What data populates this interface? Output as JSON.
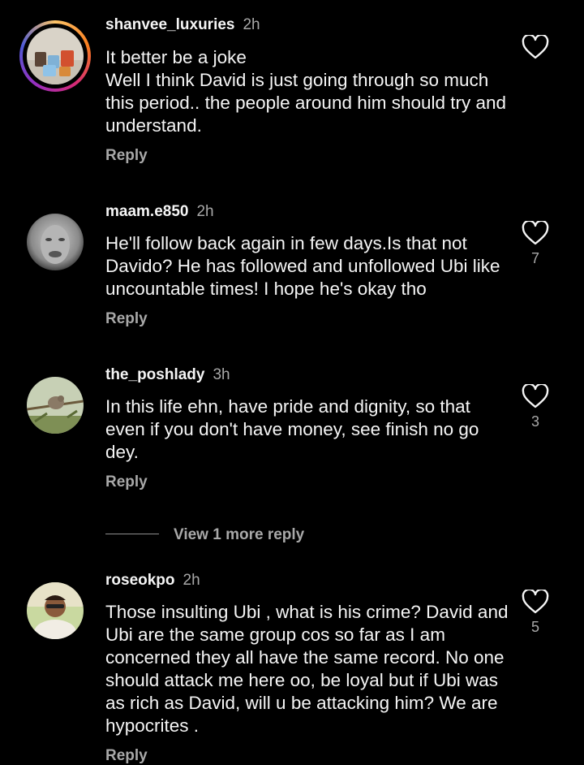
{
  "comments": [
    {
      "username": "shanvee_luxuries",
      "time": "2h",
      "text": "It better be a joke\nWell I think David is just going through so much this period.. the people around him should try and understand.",
      "reply": "Reply",
      "likes": ""
    },
    {
      "username": "maam.e850",
      "time": "2h",
      "text": "He'll follow back again in few days.Is that not Davido? He has followed and unfollowed Ubi like uncountable times! I hope he's okay tho",
      "reply": "Reply",
      "likes": "7"
    },
    {
      "username": "the_poshlady",
      "time": "3h",
      "text": "In this life ehn, have pride and dignity, so that even if you don't have money, see finish no go dey.",
      "reply": "Reply",
      "likes": "3"
    },
    {
      "username": "roseokpo",
      "time": "2h",
      "text": "Those insulting Ubi , what is his crime? David and Ubi are the same group cos so far as I am concerned they all have the same record. No one should attack me here oo, be loyal but if Ubi was as rich as David, will u be attacking him? We are hypocrites .",
      "reply": "Reply",
      "likes": "5"
    }
  ],
  "view_more": "View 1 more reply",
  "icons": {
    "like": "heart-outline-icon"
  },
  "colors": {
    "background": "#000000",
    "text": "#f5f5f5",
    "secondary": "#a8a8a8"
  }
}
